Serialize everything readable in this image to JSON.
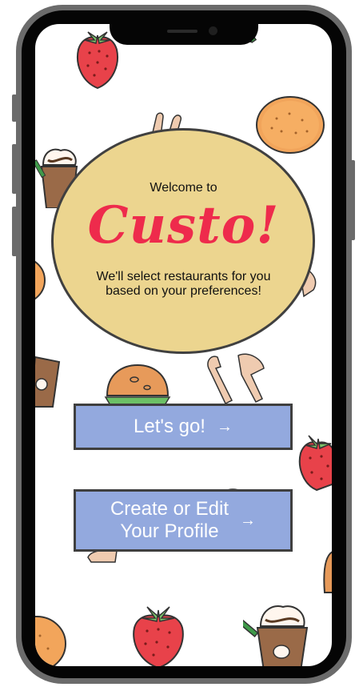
{
  "welcome": {
    "prefix": "Welcome to",
    "logo": "Custo!",
    "tagline_line1": "We'll select restaurants for you",
    "tagline_line2": "based on your preferences!"
  },
  "actions": {
    "lets_go_label": "Let's go!",
    "lets_go_icon": "arrow-right-icon",
    "profile_label": "Create or Edit\nYour Profile",
    "profile_icon": "arrow-right-icon"
  },
  "colors": {
    "logo": "#ee2b4c",
    "ellipse_fill": "#ecd58f",
    "button_fill": "#93a9de",
    "button_border": "#3f3f3f"
  }
}
